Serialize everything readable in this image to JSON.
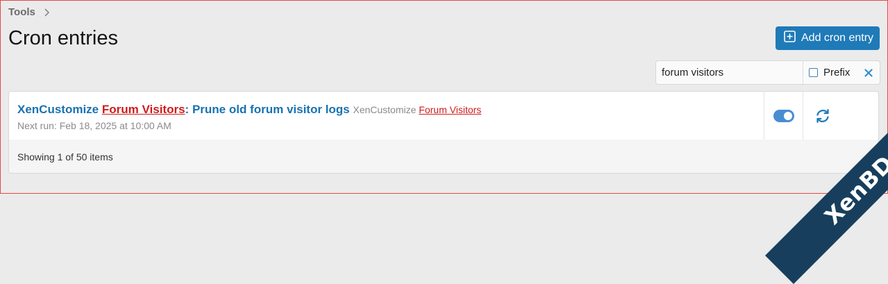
{
  "breadcrumb": {
    "items": [
      "Tools"
    ]
  },
  "page": {
    "title": "Cron entries"
  },
  "toolbar": {
    "add_label": "Add cron entry"
  },
  "filter": {
    "value": "forum visitors",
    "prefix_label": "Prefix",
    "prefix_checked": false
  },
  "list": {
    "rows": [
      {
        "addon": "XenCustomize",
        "addon_highlight": "Forum Visitors",
        "colon": ":",
        "title": "Prune old forum visitor logs",
        "source_addon": "XenCustomize",
        "source_highlight": "Forum Visitors",
        "next_run": "Next run: Feb 18, 2025 at 10:00 AM",
        "enabled": true
      }
    ],
    "footer": "Showing 1 of 50 items"
  },
  "watermark": {
    "text": "XenBD.Com"
  },
  "colors": {
    "accent": "#1f7ab8",
    "link": "#1872b0",
    "highlight": "#cf1b1b",
    "toggle_on": "#4a8cd0"
  }
}
